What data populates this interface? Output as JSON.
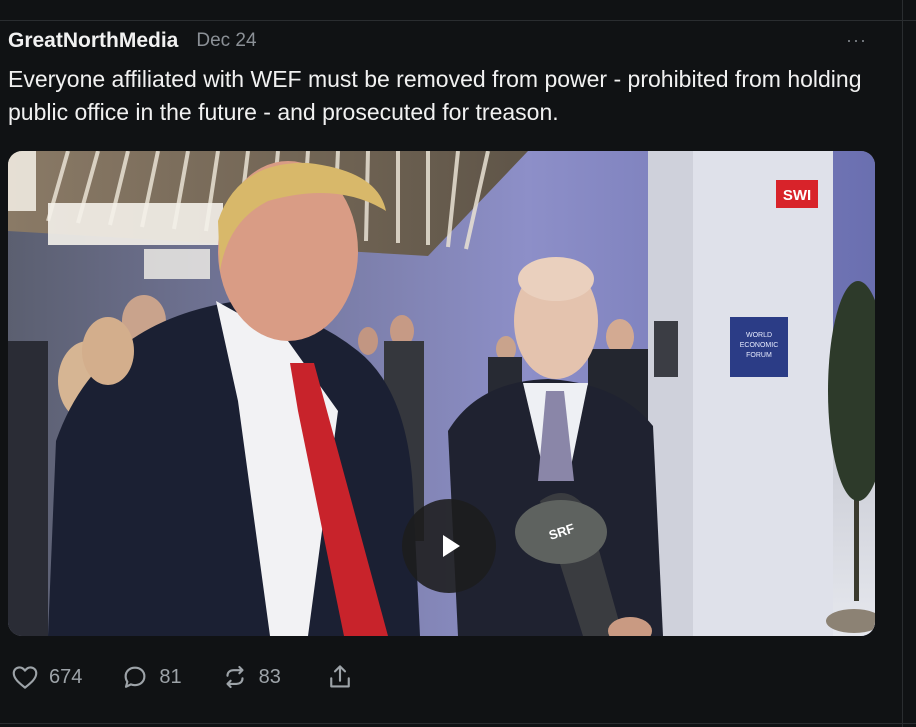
{
  "post": {
    "author": "GreatNorthMedia",
    "date": "Dec 24",
    "more": "···",
    "text": "Everyone affiliated with WEF must be removed from power - prohibited from holding public office in the future - and prosecuted for treason."
  },
  "media": {
    "type": "video",
    "watermark": "SWI",
    "sign_text": "WORLD ECONOMIC FORUM",
    "mic_label": "SRF",
    "play_icon": "play-icon"
  },
  "actions": {
    "likes": "674",
    "replies": "81",
    "reposts": "83",
    "icons": [
      "heart-icon",
      "reply-bubble-icon",
      "repost-icon",
      "share-icon"
    ]
  },
  "colors": {
    "background": "#101214",
    "text": "#f1f1f1",
    "muted": "#8b9096",
    "tie": "#c8232b",
    "swi_badge": "#d8232a"
  }
}
